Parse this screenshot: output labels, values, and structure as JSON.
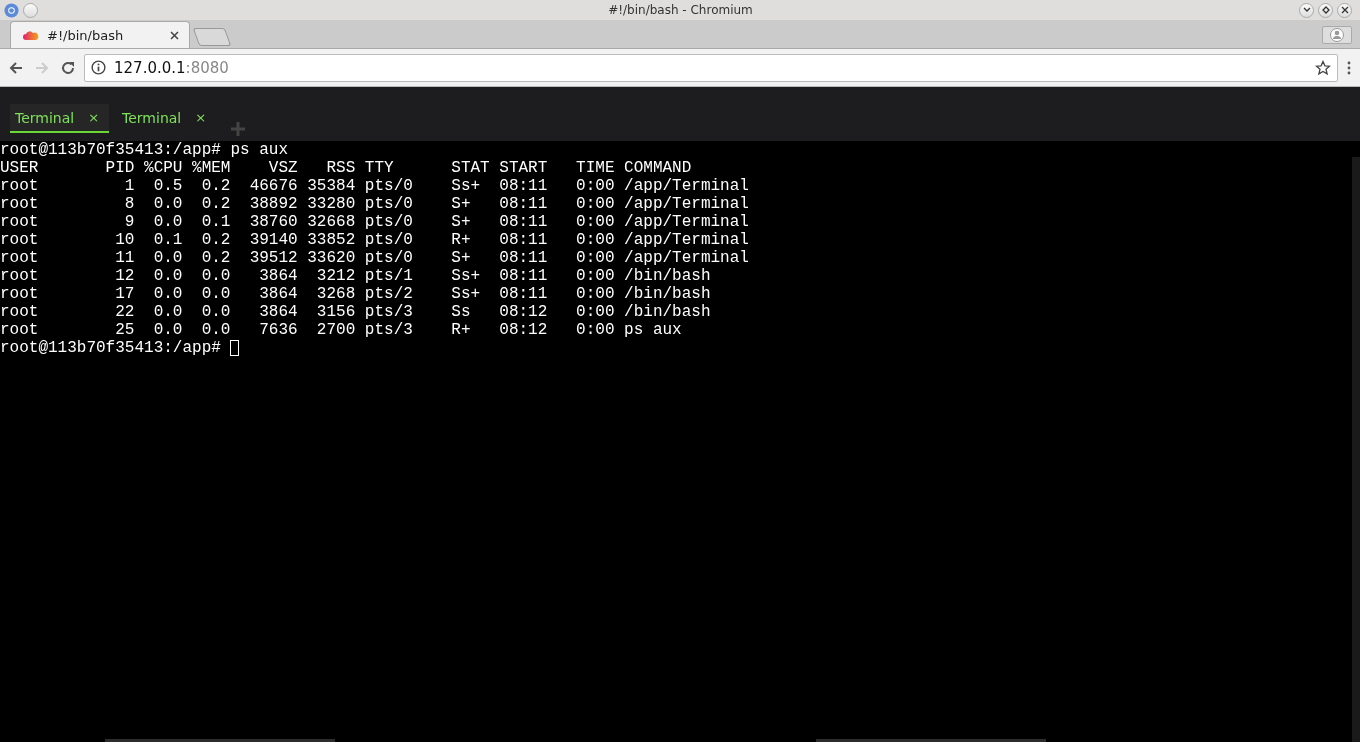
{
  "window": {
    "title": "#!/bin/bash - Chromium"
  },
  "browser_tabs": [
    {
      "label": "#!/bin/bash",
      "selected": true
    }
  ],
  "address_bar": {
    "host": "127.0.0.1",
    "port": ":8080"
  },
  "terminal_tabs": [
    {
      "label": "Terminal",
      "close": "×",
      "selected": true
    },
    {
      "label": "Terminal",
      "close": "×",
      "selected": false
    }
  ],
  "terminal": {
    "lines": [
      "root@113b70f35413:/app# ps aux",
      "USER       PID %CPU %MEM    VSZ   RSS TTY      STAT START   TIME COMMAND",
      "root         1  0.5  0.2  46676 35384 pts/0    Ss+  08:11   0:00 /app/Terminal",
      "root         8  0.0  0.2  38892 33280 pts/0    S+   08:11   0:00 /app/Terminal",
      "root         9  0.0  0.1  38760 32668 pts/0    S+   08:11   0:00 /app/Terminal",
      "root        10  0.1  0.2  39140 33852 pts/0    R+   08:11   0:00 /app/Terminal",
      "root        11  0.0  0.2  39512 33620 pts/0    S+   08:11   0:00 /app/Terminal",
      "root        12  0.0  0.0   3864  3212 pts/1    Ss+  08:11   0:00 /bin/bash",
      "root        17  0.0  0.0   3864  3268 pts/2    Ss+  08:11   0:00 /bin/bash",
      "root        22  0.0  0.0   3864  3156 pts/3    Ss   08:12   0:00 /bin/bash",
      "root        25  0.0  0.0   7636  2700 pts/3    R+   08:12   0:00 ps aux"
    ],
    "prompt": "root@113b70f35413:/app#"
  }
}
